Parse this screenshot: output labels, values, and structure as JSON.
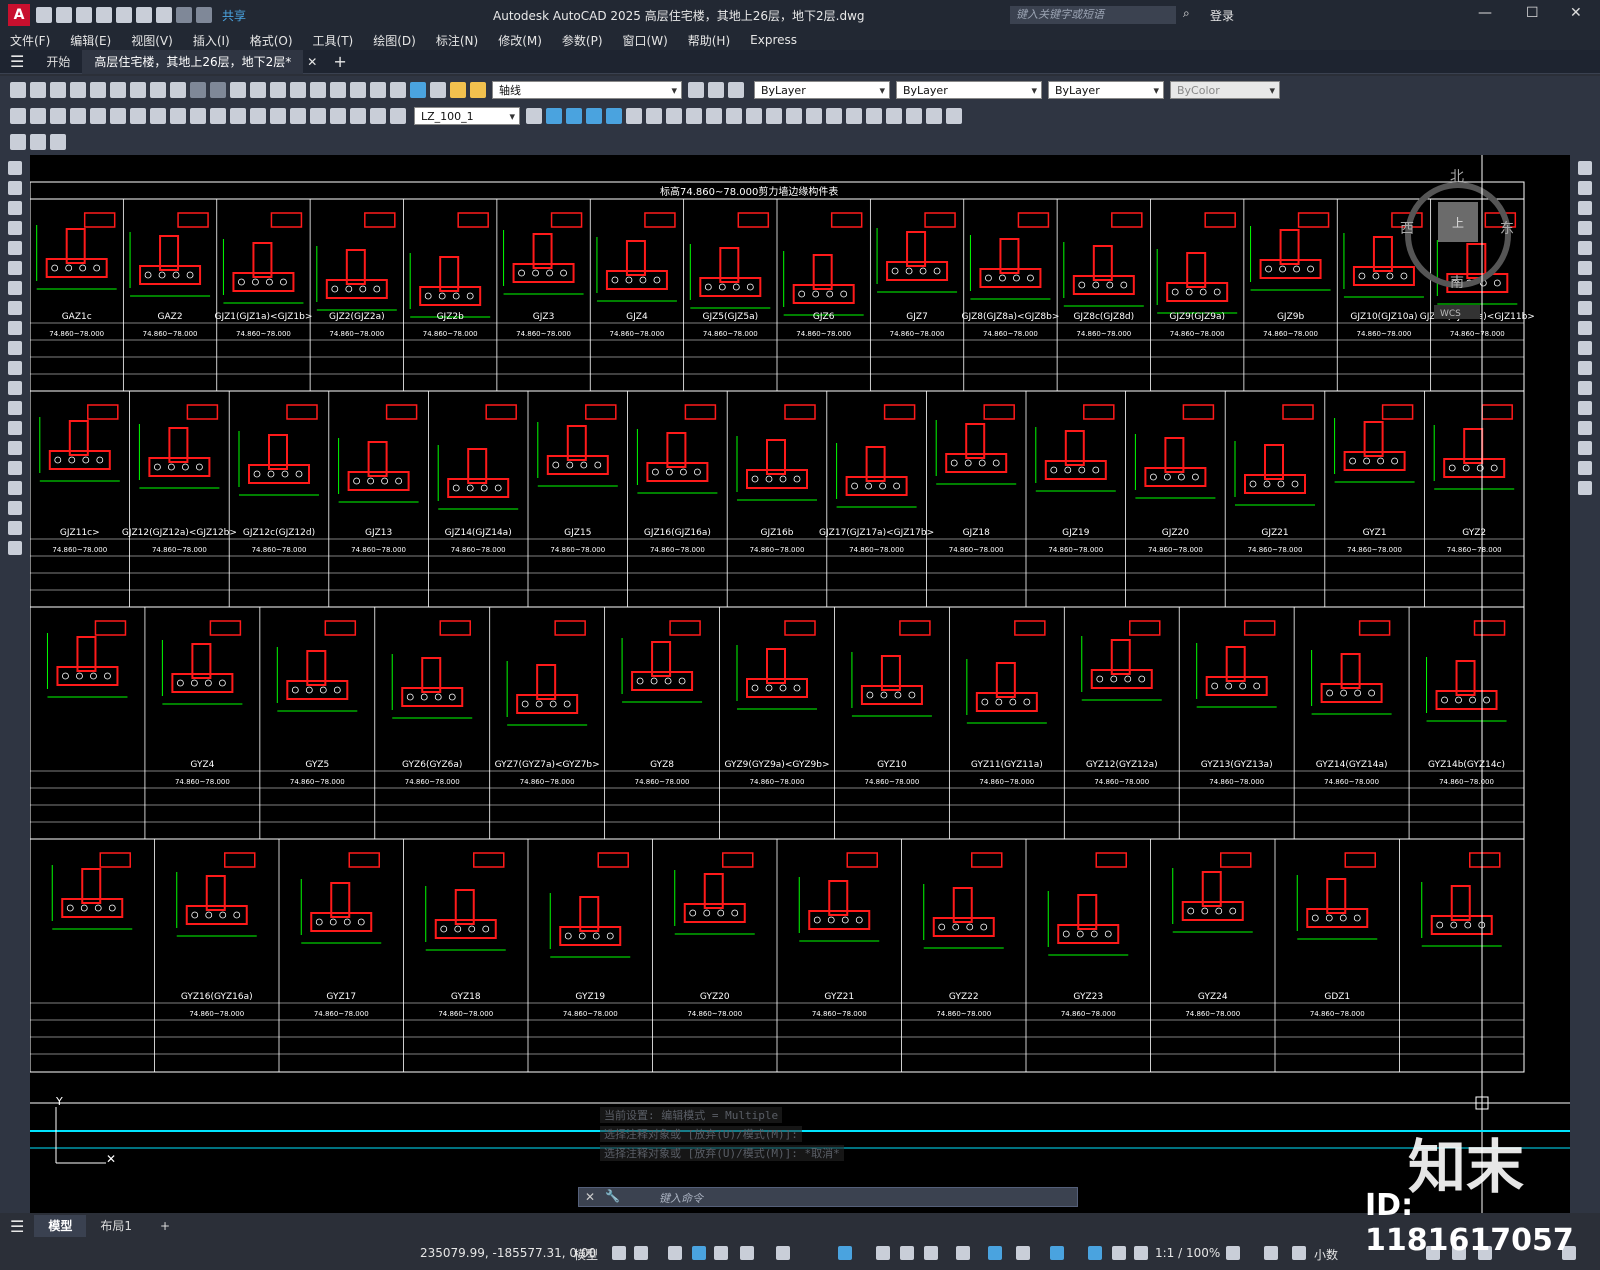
{
  "app": {
    "title": "Autodesk AutoCAD 2025    高层住宅楼，其地上26层，地下2层.dwg",
    "share": "共享",
    "search_placeholder": "键入关键字或短语",
    "login": "登录"
  },
  "menu": [
    "文件(F)",
    "编辑(E)",
    "视图(V)",
    "插入(I)",
    "格式(O)",
    "工具(T)",
    "绘图(D)",
    "标注(N)",
    "修改(M)",
    "参数(P)",
    "窗口(W)",
    "帮助(H)",
    "Express"
  ],
  "tabs": {
    "start": "开始",
    "doc": "高层住宅楼，其地上26层，地下2层*"
  },
  "toolbar": {
    "layer": "轴线",
    "color": "ByLayer",
    "linetype": "ByLayer",
    "lineweight": "ByLayer",
    "plotstyle": "ByColor",
    "dimstyle": "LZ_100_1"
  },
  "drawing": {
    "table_title": "标高74.860~78.000剪力墙边缘构件表",
    "height_value": "74.860~78.000",
    "row1": [
      "GAZ1c",
      "GAZ2",
      "GJZ1(GJZ1a)<GJZ1b>",
      "GJZ2(GJZ2a)",
      "GJZ2b",
      "GJZ3",
      "GJZ4",
      "GJZ5(GJZ5a)",
      "GJZ6",
      "GJZ7",
      "GJZ8(GJZ8a)<GJZ8b>",
      "GJZ8c(GJZ8d)",
      "GJZ9(GJZ9a)",
      "GJZ9b",
      "GJZ10(GJZ10a)",
      "GJZ11(GJZ11a)<GJZ11b>"
    ],
    "row2": [
      "GJZ11c>",
      "GJZ12(GJZ12a)<GJZ12b>",
      "GJZ12c(GJZ12d)",
      "GJZ13",
      "GJZ14(GJZ14a)",
      "GJZ15",
      "GJZ16(GJZ16a)",
      "GJZ16b",
      "GJZ17(GJZ17a)<GJZ17b>",
      "GJZ18",
      "GJZ19",
      "GJZ20",
      "GJZ21",
      "GYZ1",
      "GYZ2"
    ],
    "row3": [
      "",
      "GYZ4",
      "GYZ5",
      "GYZ6(GYZ6a)",
      "GYZ7(GYZ7a)<GYZ7b>",
      "GYZ8",
      "GYZ9(GYZ9a)<GYZ9b>",
      "GYZ10",
      "GYZ11(GYZ11a)",
      "GYZ12(GYZ12a)",
      "GYZ13(GYZ13a)",
      "GYZ14(GYZ14a)",
      "GYZ14b(GYZ14c)"
    ],
    "row4": [
      "",
      "GYZ16(GYZ16a)",
      "GYZ17",
      "GYZ18",
      "GYZ19",
      "GYZ20",
      "GYZ21",
      "GYZ22",
      "GYZ23",
      "GYZ24",
      "GDZ1",
      ""
    ],
    "compass": {
      "north": "北",
      "south": "南",
      "east": "东",
      "west": "西",
      "top": "上",
      "wcs": "WCS"
    }
  },
  "command": {
    "log1": "当前设置: 编辑模式 = Multiple",
    "log2": "选择注释对象或 [放弃(U)/模式(M)]:",
    "log3": "选择注释对象或 [放弃(U)/模式(M)]: *取消*",
    "placeholder": "键入命令"
  },
  "status": {
    "model_tab": "模型",
    "layout_tab": "布局1",
    "coords": "235079.99, -185577.31, 0.00",
    "model": "模型",
    "scale": "1:1 / 100%",
    "units": "小数"
  },
  "watermark": {
    "logo": "知末",
    "id": "ID: 1181617057"
  },
  "colors": {
    "ui_bg": "#2b2f38",
    "canvas": "#000000",
    "line_white": "#ffffff",
    "rebar_red": "#ff1a1a",
    "dim_green": "#00ff00",
    "cyan": "#00e5ff"
  }
}
